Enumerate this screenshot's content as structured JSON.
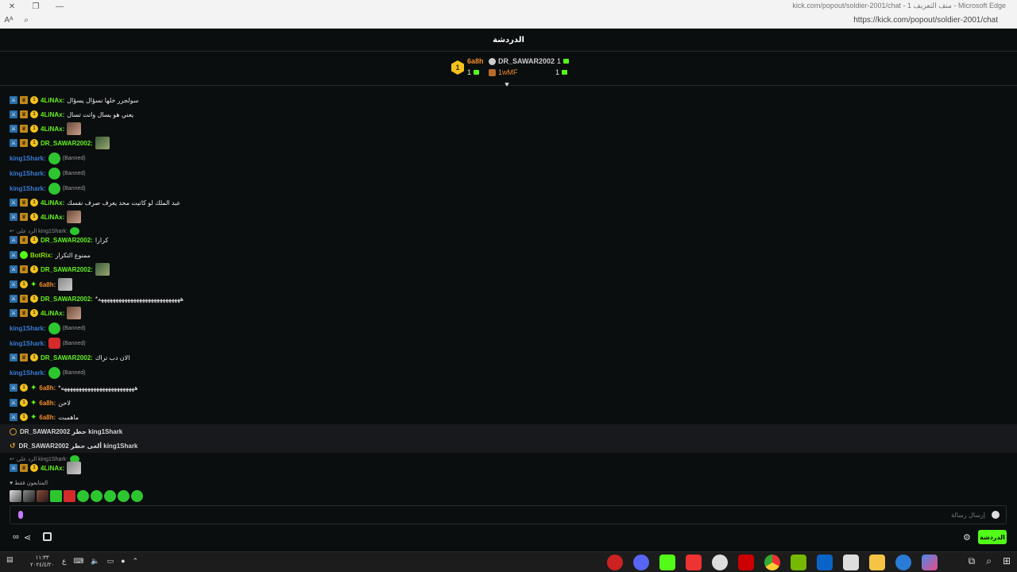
{
  "browser": {
    "window_title": "kick.com/popout/soldier-2001/chat - منف التعريف 1 - Microsoft Edge",
    "url": "https://kick.com/popout/soldier-2001/chat"
  },
  "chat_header": {
    "title": "الدردشة"
  },
  "leaderboard": {
    "rank_badge": "1",
    "items": [
      {
        "name": "6a8h",
        "count": "1"
      },
      {
        "name": "DR_SAWAR2002",
        "count": "1"
      },
      {
        "name": "1wMF",
        "count": "1"
      }
    ]
  },
  "messages": [
    {
      "user": "4LiNAx:",
      "text": "سولجرر خلها نسؤال يسؤال"
    },
    {
      "user": "4LiNAx:",
      "text": "يعني هو يسال وانت تسال"
    },
    {
      "user": "4LiNAx:",
      "text": ""
    },
    {
      "user": "DR_SAWAR2002:",
      "text": ""
    },
    {
      "user": "king1Shark:",
      "text": "(Banned)"
    },
    {
      "user": "king1Shark:",
      "text": "(Banned)"
    },
    {
      "user": "king1Shark:",
      "text": "(Banned)"
    },
    {
      "user": "4LiNAx:",
      "text": "عبد الملك لو كانيت محد يعرف صرف نفسك"
    },
    {
      "user": "4LiNAx:",
      "text": ""
    },
    {
      "reply_to": "الرد على king1Shark:"
    },
    {
      "user": "DR_SAWAR2002:",
      "text": "كرارا"
    },
    {
      "user": "BotRix:",
      "text": "ممنوع التكرار"
    },
    {
      "user": "DR_SAWAR2002:",
      "text": ""
    },
    {
      "user": "6a8h:",
      "text": ""
    },
    {
      "user": "DR_SAWAR2002:",
      "text": "*ههههههههههههههههههههههههههههه"
    },
    {
      "user": "4LiNAx:",
      "text": ""
    },
    {
      "user": "king1Shark:",
      "text": "(Banned)"
    },
    {
      "user": "king1Shark:",
      "text": "(Banned)"
    },
    {
      "user": "DR_SAWAR2002:",
      "text": "الان دب تراك"
    },
    {
      "user": "king1Shark:",
      "text": "(Banned)"
    },
    {
      "user": "6a8h:",
      "text": "*هههههههههههههههههههههههههه"
    },
    {
      "user": "6a8h:",
      "text": "لاحن"
    },
    {
      "user": "6a8h:",
      "text": "ماهمبت"
    }
  ],
  "system_rows": [
    {
      "text": "DR_SAWAR2002 حظر king1Shark"
    },
    {
      "text": "DR_SAWAR2002 ألغى حظر king1Shark"
    }
  ],
  "last_reply": "الرد على king1Shark:",
  "last_message": {
    "user": "4LiNAx:"
  },
  "emote_bar_label": "المتابعون فقط",
  "input": {
    "placeholder": "إرسال رسالة"
  },
  "chat_button": "الدردشة",
  "taskbar": {
    "time": "١١:٣٣",
    "date": "٢٠٢٤/٤/٢٠",
    "lang": "ع"
  }
}
